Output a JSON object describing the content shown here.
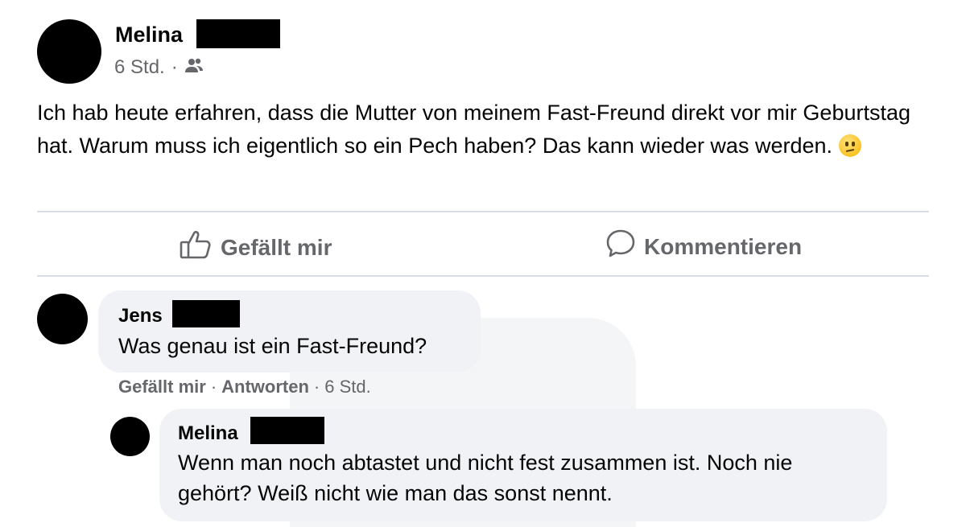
{
  "post": {
    "author": "Melina",
    "time": "6 Std.",
    "separator": "·",
    "audience_icon": "friends-icon",
    "text": "Ich hab heute erfahren, dass die Mutter von meinem Fast-Freund direkt vor mir Geburtstag hat. Warum muss ich eigentlich so ein Pech haben? Das kann wieder was werden.",
    "emoji": "confused-face-emoji"
  },
  "actions": {
    "like_label": "Gefällt mir",
    "comment_label": "Kommentieren"
  },
  "comments": [
    {
      "author": "Jens",
      "text": "Was genau ist ein Fast-Freund?",
      "like_label": "Gefällt mir",
      "reply_label": "Antworten",
      "time": "6 Std.",
      "sep": "·"
    }
  ],
  "reply": {
    "author": "Melina",
    "text": "Wenn man noch abtastet und nicht fest zusammen ist. Noch nie gehört? Weiß nicht wie man das sonst nennt."
  }
}
